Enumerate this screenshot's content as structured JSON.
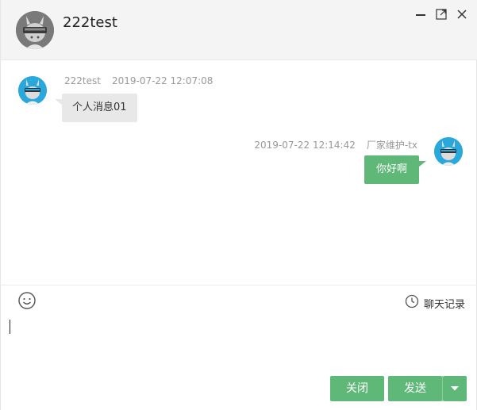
{
  "header": {
    "title": "222test"
  },
  "window_controls": {
    "icons": [
      "minimize-icon",
      "maximize-icon",
      "close-icon"
    ]
  },
  "messages": [
    {
      "direction": "incoming",
      "sender": "222test",
      "timestamp": "2019-07-22 12:07:08",
      "text": "个人消息01"
    },
    {
      "direction": "outgoing",
      "sender": "厂家维护-tx",
      "timestamp": "2019-07-22 12:14:42",
      "text": "你好啊"
    }
  ],
  "toolbar": {
    "emoji_icon": "smiley-icon",
    "history_icon": "clock-icon",
    "history_label": "聊天记录"
  },
  "input": {
    "value": "",
    "placeholder": ""
  },
  "actions": {
    "close_label": "关闭",
    "send_label": "发送",
    "dropdown_icon": "caret-down-icon"
  },
  "colors": {
    "header_bg": "#f4f4f4",
    "accent": "#5fb878",
    "incoming_bubble": "#e8e8e8",
    "meta_text": "#999999"
  }
}
